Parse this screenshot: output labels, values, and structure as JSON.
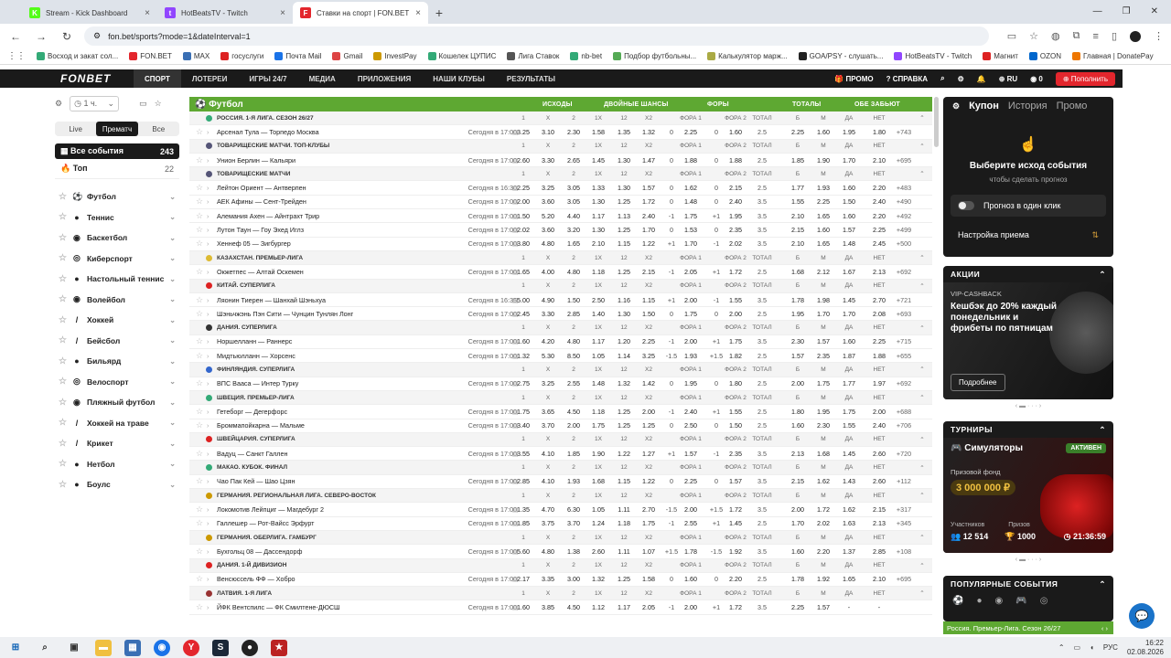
{
  "browser": {
    "tabs": [
      {
        "title": "Stream - Kick Dashboard",
        "fav": "K",
        "color": "#53fc18"
      },
      {
        "title": "HotBeatsTV - Twitch",
        "fav": "t",
        "color": "#9146ff"
      },
      {
        "title": "Ставки на спорт | FON.BET",
        "fav": "F",
        "color": "#e3262d"
      }
    ],
    "url": "fon.bet/sports?mode=1&dateInterval=1",
    "bookmarks": [
      "Восход и закат сол...",
      "FON.BET",
      "MAX",
      "госуслуги",
      "Почта Mail",
      "Gmail",
      "InvestPay",
      "Кошелек ЦУПИС",
      "Лига Ставок",
      "nb-bet",
      "Подбор футбольны...",
      "Калькулятор марж...",
      "GOA/PSY - слушать...",
      "HotBeatsTV - Twitch",
      "Магнит",
      "OZON",
      "Главная | DonatePay"
    ]
  },
  "nav": {
    "logo": "FONBET",
    "items": [
      "СПОРТ",
      "ЛОТЕРЕИ",
      "ИГРЫ 24/7",
      "МЕДИА",
      "ПРИЛОЖЕНИЯ",
      "НАШИ КЛУБЫ",
      "РЕЗУЛЬТАТЫ"
    ],
    "promo": "ПРОМО",
    "help": "СПРАВКА",
    "lang": "RU",
    "balance": "0",
    "topup": "Пополнить"
  },
  "sidebar": {
    "period": "1 ч.",
    "tabs": [
      "Live",
      "Прематч",
      "Все"
    ],
    "all_events": "Все события",
    "all_count": "243",
    "top": "Топ",
    "top_count": "22",
    "sports": [
      {
        "name": "Футбол",
        "icon": "⚽"
      },
      {
        "name": "Теннис",
        "icon": "●"
      },
      {
        "name": "Баскетбол",
        "icon": "◉"
      },
      {
        "name": "Киберспорт",
        "icon": "◎"
      },
      {
        "name": "Настольный теннис",
        "icon": "●"
      },
      {
        "name": "Волейбол",
        "icon": "◉"
      },
      {
        "name": "Хоккей",
        "icon": "/"
      },
      {
        "name": "Бейсбол",
        "icon": "/"
      },
      {
        "name": "Бильярд",
        "icon": "●"
      },
      {
        "name": "Велоспорт",
        "icon": "◎"
      },
      {
        "name": "Пляжный футбол",
        "icon": "◉"
      },
      {
        "name": "Хоккей на траве",
        "icon": "/"
      },
      {
        "name": "Крикет",
        "icon": "/"
      },
      {
        "name": "Нетбол",
        "icon": "●"
      },
      {
        "name": "Боулс",
        "icon": "●"
      }
    ]
  },
  "table": {
    "sport": "Футбол",
    "groups": [
      "ИСХОДЫ",
      "ДВОЙНЫЕ ШАНСЫ",
      "ФОРЫ",
      "ТОТАЛЫ",
      "ОБЕ ЗАБЬЮТ"
    ],
    "rows": [
      {
        "t": "L",
        "n": "РОССИЯ. 1-Я ЛИГА. СЕЗОН 26/27",
        "c": "#3a7",
        "cols": [
          "1",
          "X",
          "2",
          "1X",
          "12",
          "X2",
          "",
          "ФОРА 1",
          "",
          "ФОРА 2",
          "ТОТАЛ",
          "Б",
          "М",
          "ДА",
          "НЕТ"
        ]
      },
      {
        "t": "E",
        "n": "Арсенал Тула — Торпедо Москва",
        "tm": "Сегодня в 17:00",
        "cols": [
          "3.25",
          "3.10",
          "2.30",
          "1.58",
          "1.35",
          "1.32",
          "0",
          "2.25",
          "0",
          "1.60",
          "2.5",
          "2.25",
          "1.60",
          "1.95",
          "1.80",
          "+743"
        ]
      },
      {
        "t": "L",
        "n": "ТОВАРИЩЕСКИЕ МАТЧИ. ТОП-КЛУБЫ",
        "c": "#557",
        "cols": [
          "1",
          "X",
          "2",
          "1X",
          "12",
          "X2",
          "",
          "ФОРА 1",
          "",
          "ФОРА 2",
          "ТОТАЛ",
          "Б",
          "М",
          "ДА",
          "НЕТ"
        ]
      },
      {
        "t": "E",
        "n": "Унион Берлин — Кальяри",
        "tm": "Сегодня в 17:00",
        "cols": [
          "2.60",
          "3.30",
          "2.65",
          "1.45",
          "1.30",
          "1.47",
          "0",
          "1.88",
          "0",
          "1.88",
          "2.5",
          "1.85",
          "1.90",
          "1.70",
          "2.10",
          "+695"
        ]
      },
      {
        "t": "L",
        "n": "ТОВАРИЩЕСКИЕ МАТЧИ",
        "c": "#557",
        "cols": [
          "1",
          "X",
          "2",
          "1X",
          "12",
          "X2",
          "",
          "ФОРА 1",
          "",
          "ФОРА 2",
          "ТОТАЛ",
          "Б",
          "М",
          "ДА",
          "НЕТ"
        ]
      },
      {
        "t": "E",
        "n": "Лейтон Ориент — Антверпен",
        "tm": "Сегодня в 16:30",
        "cols": [
          "2.25",
          "3.25",
          "3.05",
          "1.33",
          "1.30",
          "1.57",
          "0",
          "1.62",
          "0",
          "2.15",
          "2.5",
          "1.77",
          "1.93",
          "1.60",
          "2.20",
          "+483"
        ]
      },
      {
        "t": "E",
        "n": "АЕК Афины — Сент-Трейден",
        "tm": "Сегодня в 17:00",
        "cols": [
          "2.00",
          "3.60",
          "3.05",
          "1.30",
          "1.25",
          "1.72",
          "0",
          "1.48",
          "0",
          "2.40",
          "3.5",
          "1.55",
          "2.25",
          "1.50",
          "2.40",
          "+490"
        ]
      },
      {
        "t": "E",
        "n": "Алемания Ахен — Айнтрахт Трир",
        "tm": "Сегодня в 17:00",
        "cols": [
          "1.50",
          "5.20",
          "4.40",
          "1.17",
          "1.13",
          "2.40",
          "-1",
          "1.75",
          "+1",
          "1.95",
          "3.5",
          "2.10",
          "1.65",
          "1.60",
          "2.20",
          "+492"
        ]
      },
      {
        "t": "E",
        "n": "Лутон Таун — Гоу Эхед Иглз",
        "tm": "Сегодня в 17:00",
        "cols": [
          "2.02",
          "3.60",
          "3.20",
          "1.30",
          "1.25",
          "1.70",
          "0",
          "1.53",
          "0",
          "2.35",
          "3.5",
          "2.15",
          "1.60",
          "1.57",
          "2.25",
          "+499"
        ]
      },
      {
        "t": "E",
        "n": "Хеннеф 05 — Зигбургер",
        "tm": "Сегодня в 17:00",
        "cols": [
          "3.80",
          "4.80",
          "1.65",
          "2.10",
          "1.15",
          "1.22",
          "+1",
          "1.70",
          "-1",
          "2.02",
          "3.5",
          "2.10",
          "1.65",
          "1.48",
          "2.45",
          "+500"
        ]
      },
      {
        "t": "L",
        "n": "КАЗАХСТАН. ПРЕМЬЕР-ЛИГА",
        "c": "#db3",
        "cols": [
          "1",
          "X",
          "2",
          "1X",
          "12",
          "X2",
          "",
          "ФОРА 1",
          "",
          "ФОРА 2",
          "ТОТАЛ",
          "Б",
          "М",
          "ДА",
          "НЕТ"
        ]
      },
      {
        "t": "E",
        "n": "Окжетпес — Алтай Оскемен",
        "tm": "Сегодня в 17:00",
        "cols": [
          "1.65",
          "4.00",
          "4.80",
          "1.18",
          "1.25",
          "2.15",
          "-1",
          "2.05",
          "+1",
          "1.72",
          "2.5",
          "1.68",
          "2.12",
          "1.67",
          "2.13",
          "+692"
        ]
      },
      {
        "t": "L",
        "n": "КИТАЙ. СУПЕРЛИГА",
        "c": "#d22",
        "cols": [
          "1",
          "X",
          "2",
          "1X",
          "12",
          "X2",
          "",
          "ФОРА 1",
          "",
          "ФОРА 2",
          "ТОТАЛ",
          "Б",
          "М",
          "ДА",
          "НЕТ"
        ]
      },
      {
        "t": "E",
        "n": "Ляонин Тиерен — Шанхай Шэньхуа",
        "tm": "Сегодня в 16:35",
        "cols": [
          "5.00",
          "4.90",
          "1.50",
          "2.50",
          "1.16",
          "1.15",
          "+1",
          "2.00",
          "-1",
          "1.55",
          "3.5",
          "1.78",
          "1.98",
          "1.45",
          "2.70",
          "+721"
        ]
      },
      {
        "t": "E",
        "n": "Шэньчжэнь Пэн Сити — Чунцин Тунлян Лонг",
        "tm": "Сегодня в 17:00",
        "cols": [
          "2.45",
          "3.30",
          "2.85",
          "1.40",
          "1.30",
          "1.50",
          "0",
          "1.75",
          "0",
          "2.00",
          "2.5",
          "1.95",
          "1.70",
          "1.70",
          "2.08",
          "+693"
        ]
      },
      {
        "t": "L",
        "n": "ДАНИЯ. СУПЕРЛИГА",
        "c": "#333",
        "cols": [
          "1",
          "X",
          "2",
          "1X",
          "12",
          "X2",
          "",
          "ФОРА 1",
          "",
          "ФОРА 2",
          "ТОТАЛ",
          "Б",
          "М",
          "ДА",
          "НЕТ"
        ]
      },
      {
        "t": "E",
        "n": "Норшелланн — Раннерс",
        "tm": "Сегодня в 17:00",
        "cols": [
          "1.60",
          "4.20",
          "4.80",
          "1.17",
          "1.20",
          "2.25",
          "-1",
          "2.00",
          "+1",
          "1.75",
          "3.5",
          "2.30",
          "1.57",
          "1.60",
          "2.25",
          "+715"
        ]
      },
      {
        "t": "E",
        "n": "Мидтьюлланн — Хорсенс",
        "tm": "Сегодня в 17:00",
        "cols": [
          "1.32",
          "5.30",
          "8.50",
          "1.05",
          "1.14",
          "3.25",
          "-1.5",
          "1.93",
          "+1.5",
          "1.82",
          "2.5",
          "1.57",
          "2.35",
          "1.87",
          "1.88",
          "+655"
        ]
      },
      {
        "t": "L",
        "n": "ФИНЛЯНДИЯ. СУПЕРЛИГА",
        "c": "#36c",
        "cols": [
          "1",
          "X",
          "2",
          "1X",
          "12",
          "X2",
          "",
          "ФОРА 1",
          "",
          "ФОРА 2",
          "ТОТАЛ",
          "Б",
          "М",
          "ДА",
          "НЕТ"
        ]
      },
      {
        "t": "E",
        "n": "ВПС Вааса — Интер Турку",
        "tm": "Сегодня в 17:00",
        "cols": [
          "2.75",
          "3.25",
          "2.55",
          "1.48",
          "1.32",
          "1.42",
          "0",
          "1.95",
          "0",
          "1.80",
          "2.5",
          "2.00",
          "1.75",
          "1.77",
          "1.97",
          "+692"
        ]
      },
      {
        "t": "L",
        "n": "ШВЕЦИЯ. ПРЕМЬЕР-ЛИГА",
        "c": "#3a7",
        "cols": [
          "1",
          "X",
          "2",
          "1X",
          "12",
          "X2",
          "",
          "ФОРА 1",
          "",
          "ФОРА 2",
          "ТОТАЛ",
          "Б",
          "М",
          "ДА",
          "НЕТ"
        ]
      },
      {
        "t": "E",
        "n": "Гетеборг — Дегерфорс",
        "tm": "Сегодня в 17:00",
        "cols": [
          "1.75",
          "3.65",
          "4.50",
          "1.18",
          "1.25",
          "2.00",
          "-1",
          "2.40",
          "+1",
          "1.55",
          "2.5",
          "1.80",
          "1.95",
          "1.75",
          "2.00",
          "+688"
        ]
      },
      {
        "t": "E",
        "n": "Броммапойкарна — Мальме",
        "tm": "Сегодня в 17:00",
        "cols": [
          "3.40",
          "3.70",
          "2.00",
          "1.75",
          "1.25",
          "1.25",
          "0",
          "2.50",
          "0",
          "1.50",
          "2.5",
          "1.60",
          "2.30",
          "1.55",
          "2.40",
          "+706"
        ]
      },
      {
        "t": "L",
        "n": "ШВЕЙЦАРИЯ. СУПЕРЛИГА",
        "c": "#d22",
        "cols": [
          "1",
          "X",
          "2",
          "1X",
          "12",
          "X2",
          "",
          "ФОРА 1",
          "",
          "ФОРА 2",
          "ТОТАЛ",
          "Б",
          "М",
          "ДА",
          "НЕТ"
        ]
      },
      {
        "t": "E",
        "n": "Вадуц — Санкт Галлен",
        "tm": "Сегодня в 17:00",
        "cols": [
          "3.55",
          "4.10",
          "1.85",
          "1.90",
          "1.22",
          "1.27",
          "+1",
          "1.57",
          "-1",
          "2.35",
          "3.5",
          "2.13",
          "1.68",
          "1.45",
          "2.60",
          "+720"
        ]
      },
      {
        "t": "L",
        "n": "МАКАО. КУБОК. ФИНАЛ",
        "c": "#3a7",
        "cols": [
          "1",
          "X",
          "2",
          "1X",
          "12",
          "X2",
          "",
          "ФОРА 1",
          "",
          "ФОРА 2",
          "ТОТАЛ",
          "Б",
          "М",
          "ДА",
          "НЕТ"
        ]
      },
      {
        "t": "E",
        "n": "Чао Пак Кей — Шао Цзян",
        "tm": "Сегодня в 17:00",
        "cols": [
          "2.85",
          "4.10",
          "1.93",
          "1.68",
          "1.15",
          "1.22",
          "0",
          "2.25",
          "0",
          "1.57",
          "3.5",
          "2.15",
          "1.62",
          "1.43",
          "2.60",
          "+112"
        ]
      },
      {
        "t": "L",
        "n": "ГЕРМАНИЯ. РЕГИОНАЛЬНАЯ ЛИГА. СЕВЕРО-ВОСТОК",
        "c": "#c90",
        "cols": [
          "1",
          "X",
          "2",
          "1X",
          "12",
          "X2",
          "",
          "ФОРА 1",
          "",
          "ФОРА 2",
          "ТОТАЛ",
          "Б",
          "М",
          "ДА",
          "НЕТ"
        ]
      },
      {
        "t": "E",
        "n": "Локомотив Лейпциг — Магдебург 2",
        "tm": "Сегодня в 17:00",
        "cols": [
          "1.35",
          "4.70",
          "6.30",
          "1.05",
          "1.11",
          "2.70",
          "-1.5",
          "2.00",
          "+1.5",
          "1.72",
          "3.5",
          "2.00",
          "1.72",
          "1.62",
          "2.15",
          "+317"
        ]
      },
      {
        "t": "E",
        "n": "Галлешер — Рот-Вайсс Эрфурт",
        "tm": "Сегодня в 17:00",
        "cols": [
          "1.85",
          "3.75",
          "3.70",
          "1.24",
          "1.18",
          "1.75",
          "-1",
          "2.55",
          "+1",
          "1.45",
          "2.5",
          "1.70",
          "2.02",
          "1.63",
          "2.13",
          "+345"
        ]
      },
      {
        "t": "L",
        "n": "ГЕРМАНИЯ. ОБЕРЛИГА. ГАМБУРГ",
        "c": "#c90",
        "cols": [
          "1",
          "X",
          "2",
          "1X",
          "12",
          "X2",
          "",
          "ФОРА 1",
          "",
          "ФОРА 2",
          "ТОТАЛ",
          "Б",
          "М",
          "ДА",
          "НЕТ"
        ]
      },
      {
        "t": "E",
        "n": "Бухгольц 08 — Дассендорф",
        "tm": "Сегодня в 17:00",
        "cols": [
          "5.60",
          "4.80",
          "1.38",
          "2.60",
          "1.11",
          "1.07",
          "+1.5",
          "1.78",
          "-1.5",
          "1.92",
          "3.5",
          "1.60",
          "2.20",
          "1.37",
          "2.85",
          "+108"
        ]
      },
      {
        "t": "L",
        "n": "ДАНИЯ. 1-Й ДИВИЗИОН",
        "c": "#d22",
        "cols": [
          "1",
          "X",
          "2",
          "1X",
          "12",
          "X2",
          "",
          "ФОРА 1",
          "",
          "ФОРА 2",
          "ТОТАЛ",
          "Б",
          "М",
          "ДА",
          "НЕТ"
        ]
      },
      {
        "t": "E",
        "n": "Венсюссель ФФ — Хобро",
        "tm": "Сегодня в 17:00",
        "cols": [
          "2.17",
          "3.35",
          "3.00",
          "1.32",
          "1.25",
          "1.58",
          "0",
          "1.60",
          "0",
          "2.20",
          "2.5",
          "1.78",
          "1.92",
          "1.65",
          "2.10",
          "+695"
        ]
      },
      {
        "t": "L",
        "n": "ЛАТВИЯ. 1-Я ЛИГА",
        "c": "#933",
        "cols": [
          "1",
          "X",
          "2",
          "1X",
          "12",
          "X2",
          "",
          "ФОРА 1",
          "",
          "ФОРА 2",
          "ТОТАЛ",
          "Б",
          "М",
          "ДА",
          "НЕТ"
        ]
      },
      {
        "t": "E",
        "n": "ЙФК Вентспилс — ФК Смилтене-ДЮСШ",
        "tm": "Сегодня в 17:00",
        "cols": [
          "1.60",
          "3.85",
          "4.50",
          "1.12",
          "1.17",
          "2.05",
          "-1",
          "2.00",
          "+1",
          "1.72",
          "3.5",
          "2.25",
          "1.57",
          "-",
          "-",
          ""
        ]
      }
    ]
  },
  "coupon": {
    "tabs": [
      "Купон",
      "История",
      "Промо"
    ],
    "title": "Выберите исход события",
    "subtitle": "чтобы сделать прогноз",
    "one_click": "Прогноз в один клик",
    "settings": "Настройка приема"
  },
  "promo": {
    "header": "АКЦИИ",
    "tag": "VIP-CASHBACK",
    "text": "Кешбэк до 20% каждый понедельник и фрибеты по пятницам",
    "more": "Подробнее"
  },
  "tournaments": {
    "header": "ТУРНИРЫ",
    "name": "Симуляторы",
    "status": "АКТИВЕН",
    "fund_label": "Призовой фонд",
    "fund": "3 000 000 ₽",
    "participants_label": "Участников",
    "participants": "12 514",
    "prizes_label": "Призов",
    "prizes": "1000",
    "timer": "21:36:59"
  },
  "popular": {
    "header": "ПОПУЛЯРНЫЕ СОБЫТИЯ",
    "bar": "Россия. Премьер-Лига. Сезон 26/27"
  },
  "taskbar": {
    "lang": "РУС",
    "time": "16:22",
    "date": "02.08.2026"
  }
}
